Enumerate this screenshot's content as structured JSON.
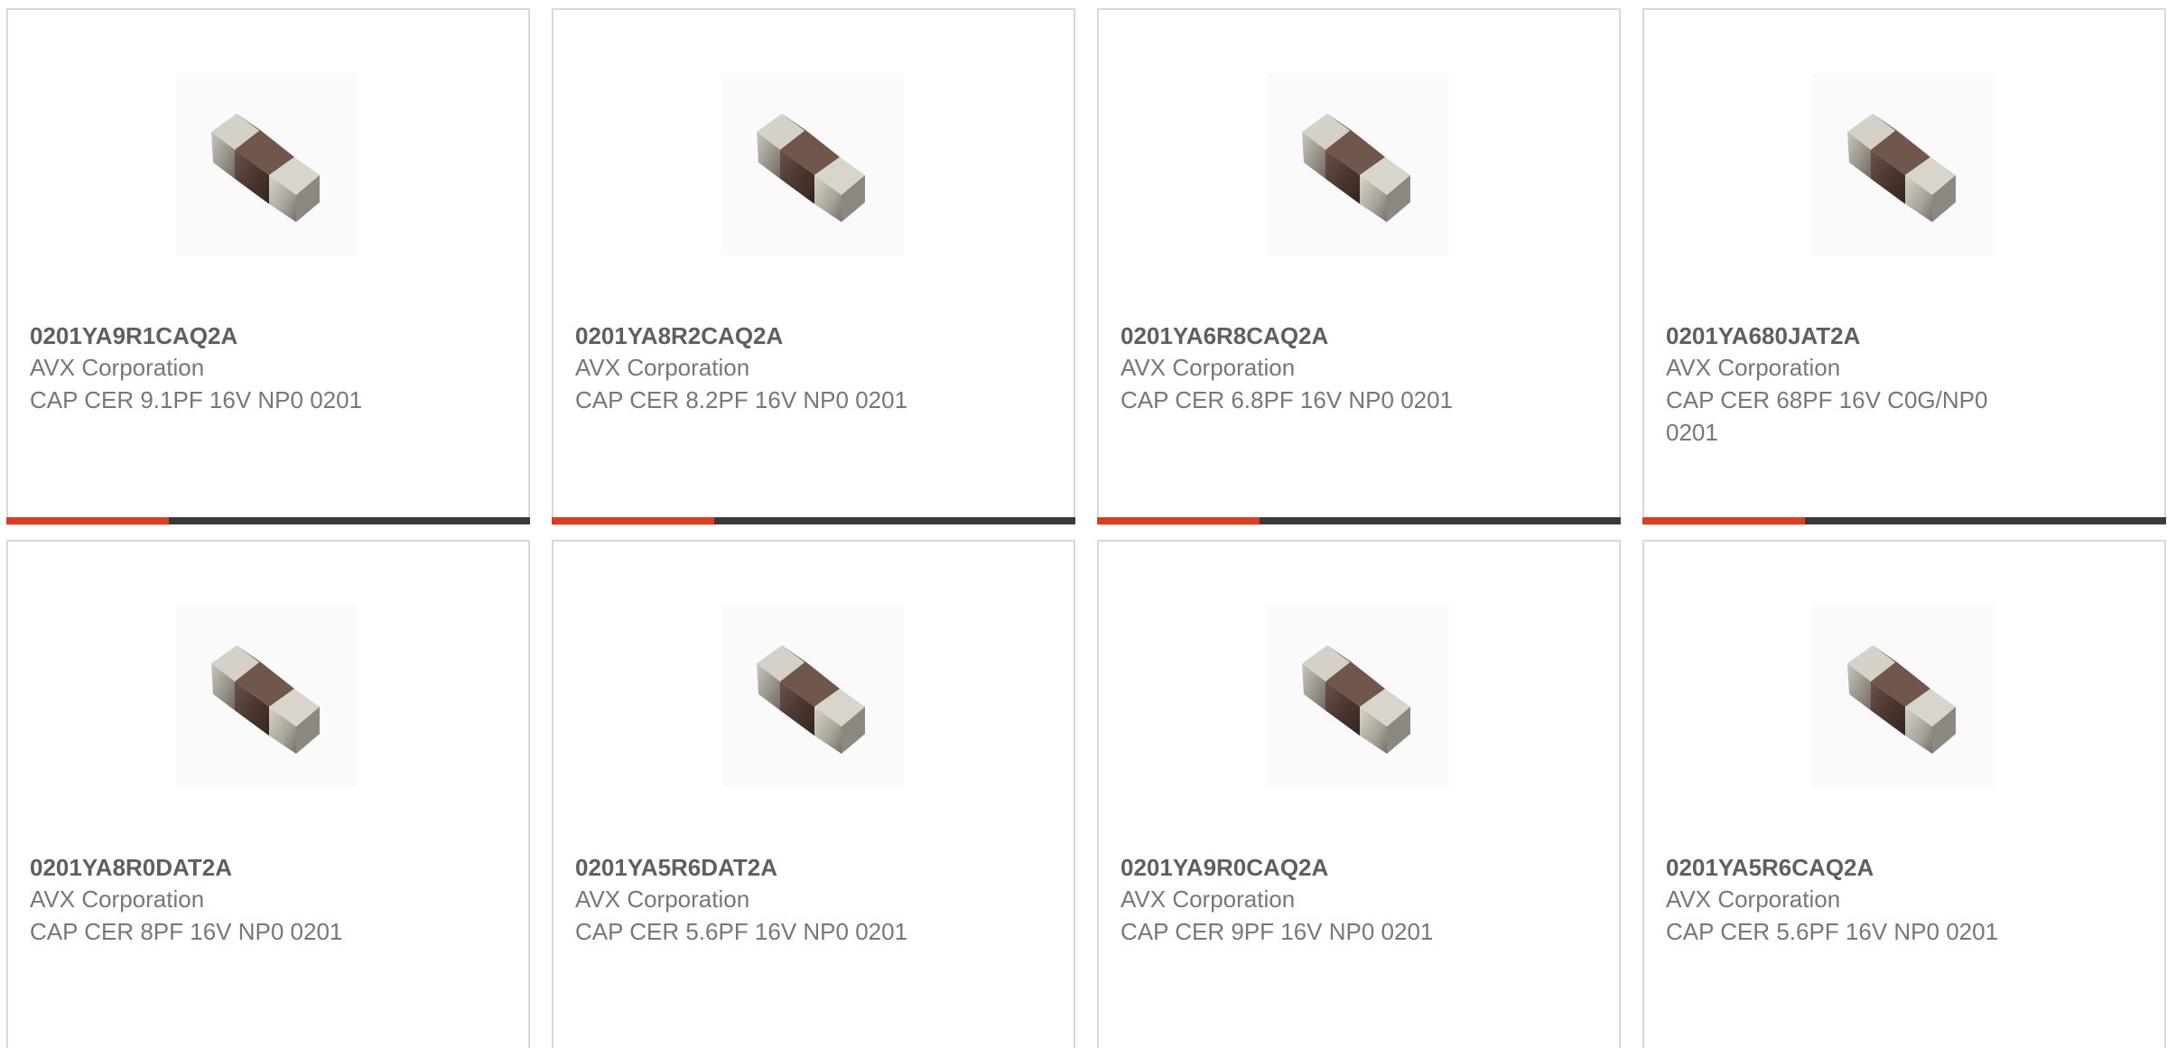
{
  "colors": {
    "accent": "#e8381b",
    "track": "#3a3a3a",
    "border": "#d9d9d9"
  },
  "products": [
    {
      "part": "0201YA9R1CAQ2A",
      "mfr": "AVX Corporation",
      "desc": "CAP CER 9.1PF 16V NP0 0201",
      "image_icon": "chip-capacitor-image",
      "progress": 0.31
    },
    {
      "part": "0201YA8R2CAQ2A",
      "mfr": "AVX Corporation",
      "desc": "CAP CER 8.2PF 16V NP0 0201",
      "image_icon": "chip-capacitor-image",
      "progress": 0.31
    },
    {
      "part": "0201YA6R8CAQ2A",
      "mfr": "AVX Corporation",
      "desc": "CAP CER 6.8PF 16V NP0 0201",
      "image_icon": "chip-capacitor-image",
      "progress": 0.31
    },
    {
      "part": "0201YA680JAT2A",
      "mfr": "AVX Corporation",
      "desc": "CAP CER 68PF 16V C0G/NP0 0201",
      "image_icon": "chip-capacitor-image",
      "progress": 0.31
    },
    {
      "part": "0201YA8R0DAT2A",
      "mfr": "AVX Corporation",
      "desc": "CAP CER 8PF 16V NP0 0201",
      "image_icon": "chip-capacitor-image"
    },
    {
      "part": "0201YA5R6DAT2A",
      "mfr": "AVX Corporation",
      "desc": "CAP CER 5.6PF 16V NP0 0201",
      "image_icon": "chip-capacitor-image"
    },
    {
      "part": "0201YA9R0CAQ2A",
      "mfr": "AVX Corporation",
      "desc": "CAP CER 9PF 16V NP0 0201",
      "image_icon": "chip-capacitor-image"
    },
    {
      "part": "0201YA5R6CAQ2A",
      "mfr": "AVX Corporation",
      "desc": "CAP CER 5.6PF 16V NP0 0201",
      "image_icon": "chip-capacitor-image"
    }
  ]
}
